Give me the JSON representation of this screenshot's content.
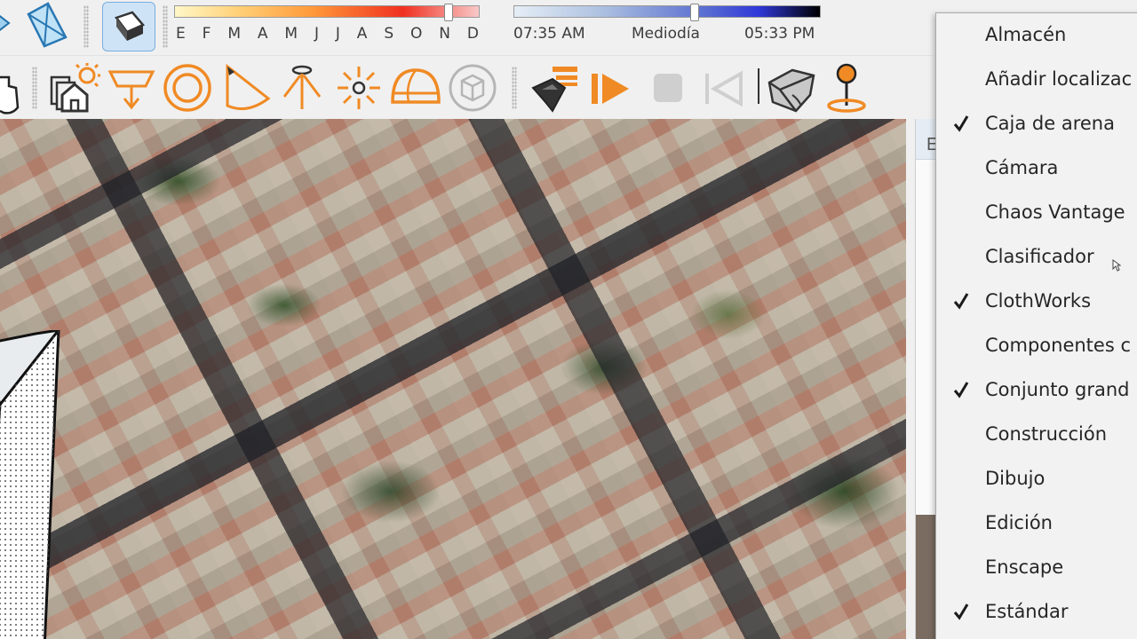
{
  "toolbar": {
    "row1": {
      "shadow_toggle_label": "",
      "month_slider": {
        "months": [
          "E",
          "F",
          "M",
          "A",
          "M",
          "J",
          "J",
          "A",
          "S",
          "O",
          "N",
          "D"
        ],
        "value": 0.9
      },
      "time_slider": {
        "start": "07:35 AM",
        "middle": "Mediodía",
        "end": "05:33 PM",
        "value": 0.59
      }
    },
    "row2": {
      "icons": [
        "hand-icon",
        "sun-house-icon",
        "push-pull-icon",
        "offset-icon",
        "cone-icon",
        "spotlight-icon",
        "light-burst-icon",
        "dome-icon",
        "box-icon",
        "curved-path-icon",
        "play-icon",
        "stop-icon",
        "skip-back-icon",
        "terrain-icon",
        "map-pin-icon"
      ]
    }
  },
  "side_panel": {
    "header_initial": "E"
  },
  "menu": {
    "items": [
      {
        "label": "Almacén",
        "checked": false
      },
      {
        "label": "Añadir localizac",
        "checked": false
      },
      {
        "label": "Caja de arena",
        "checked": true
      },
      {
        "label": "Cámara",
        "checked": false
      },
      {
        "label": "Chaos Vantage",
        "checked": false
      },
      {
        "label": "Clasificador",
        "checked": false
      },
      {
        "label": "ClothWorks",
        "checked": true
      },
      {
        "label": "Componentes c",
        "checked": false
      },
      {
        "label": "Conjunto grand",
        "checked": true
      },
      {
        "label": "Construcción",
        "checked": false
      },
      {
        "label": "Dibujo",
        "checked": false
      },
      {
        "label": "Edición",
        "checked": false
      },
      {
        "label": "Enscape",
        "checked": false
      },
      {
        "label": "Estándar",
        "checked": true
      }
    ]
  },
  "colors": {
    "accent_orange": "#f08a24",
    "active_blue": "#cfe3f7",
    "menu_bg": "#f2f2f2"
  }
}
